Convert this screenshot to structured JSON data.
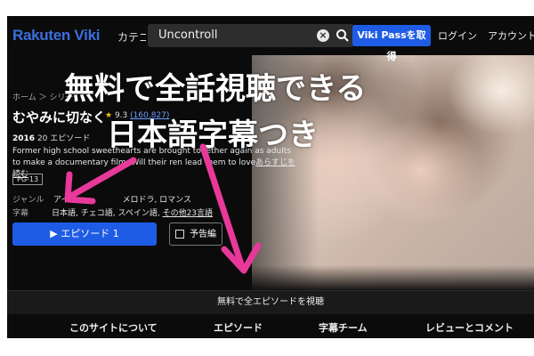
{
  "header": {
    "logo_part1": "Rakuten",
    "logo_part2": "Viki",
    "category_label": "カテゴ",
    "search_value": "Uncontroll",
    "viki_pass_button": "Viki Passを取得",
    "login": "ログイン",
    "account": "アカウントを"
  },
  "show": {
    "breadcrumb": "ホーム ＞ シリー",
    "title": "むやみに切なく",
    "rating": "9.3",
    "rating_count": "(160,827)",
    "year": "2016",
    "episodes": "20 エピソード",
    "description": "Former high school sweethearts are brought together again as adults to make a documentary film. Will their re",
    "description_tail": "n lead them to love",
    "more_link": "あらすじを読む",
    "age_rating": "PG-13",
    "genre_label": "ジャンル",
    "genre_value": "アイド",
    "genre_value_tail": "メロドラ, ロマンス",
    "subs_label": "字幕",
    "subs_value": "日本語, チェコ語, スペイン語,",
    "subs_more": "その他23言語",
    "episode_button": "▶ エピソード 1",
    "trailer_button": "予告編"
  },
  "watch_all": "無料で全エピソードを視聴",
  "tabs": [
    "このサイトについて",
    "エピソード",
    "字幕チーム",
    "レビューとコメント"
  ],
  "overlay": {
    "line1": "無料で全話視聴できる",
    "line2": "日本語字幕つき",
    "arrow_color": "#e8399a"
  },
  "colors": {
    "brand": "#3b6fe0",
    "button": "#1f5ce6"
  }
}
